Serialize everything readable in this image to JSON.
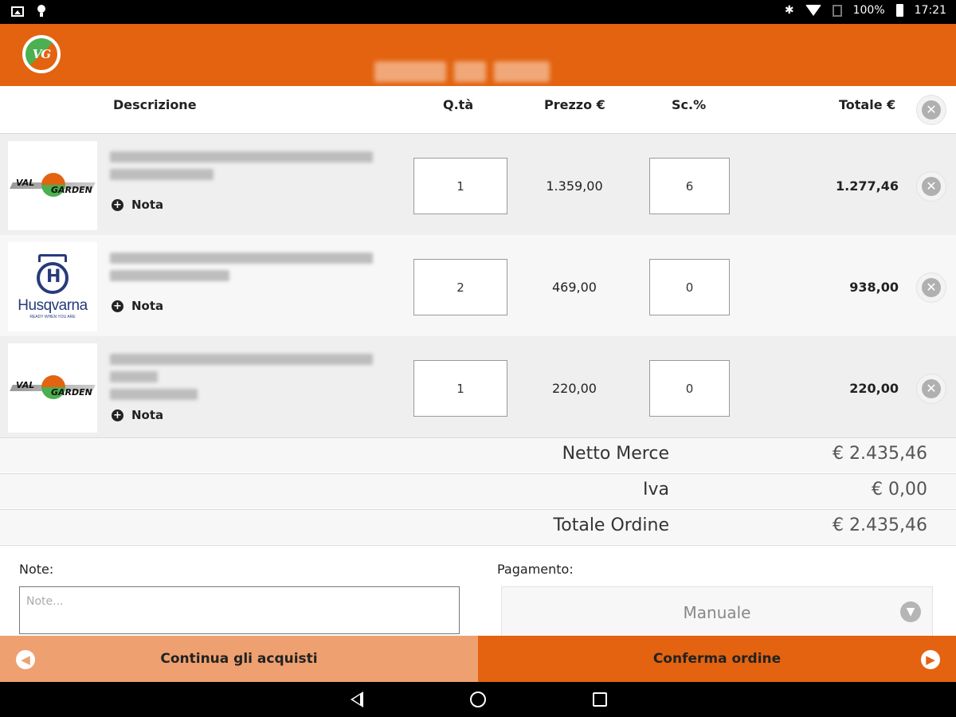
{
  "status_bar": {
    "battery": "100%",
    "time": "17:21"
  },
  "header": {
    "logo_text": "VG"
  },
  "table": {
    "columns": {
      "description": "Descrizione",
      "quantity": "Q.tà",
      "price": "Prezzo €",
      "discount": "Sc.%",
      "total": "Totale €"
    },
    "rows": [
      {
        "brand": "VAL GARDEN",
        "brand_top": "VAL",
        "brand_bottom": "GARDEN",
        "note_label": "Nota",
        "quantity": "1",
        "price": "1.359,00",
        "discount": "6",
        "total": "1.277,46"
      },
      {
        "brand": "Husqvarna",
        "brand_tagline": "READY WHEN YOU ARE",
        "note_label": "Nota",
        "quantity": "2",
        "price": "469,00",
        "discount": "0",
        "total": "938,00"
      },
      {
        "brand": "VAL GARDEN",
        "brand_top": "VAL",
        "brand_bottom": "GARDEN",
        "note_label": "Nota",
        "quantity": "1",
        "price": "220,00",
        "discount": "0",
        "total": "220,00"
      }
    ]
  },
  "summary": {
    "net_label": "Netto Merce",
    "net_value": "€ 2.435,46",
    "vat_label": "Iva",
    "vat_value": "€ 0,00",
    "total_label": "Totale Ordine",
    "total_value": "€ 2.435,46"
  },
  "form": {
    "notes_label": "Note:",
    "notes_placeholder": "Note...",
    "payment_label": "Pagamento:",
    "payment_value": "Manuale"
  },
  "actions": {
    "continue_label": "Continua gli acquisti",
    "confirm_label": "Conferma ordine"
  },
  "colors": {
    "accent": "#E36310",
    "accent_light": "#EEA070",
    "row_alt": "#EFEFEF",
    "brand_blue": "#273A7A"
  },
  "icons": {
    "remove": "close-circle-icon",
    "note": "plus-circle-icon",
    "back": "arrow-left-circle-icon",
    "forward": "arrow-right-circle-icon",
    "dropdown": "chevron-down-icon"
  }
}
